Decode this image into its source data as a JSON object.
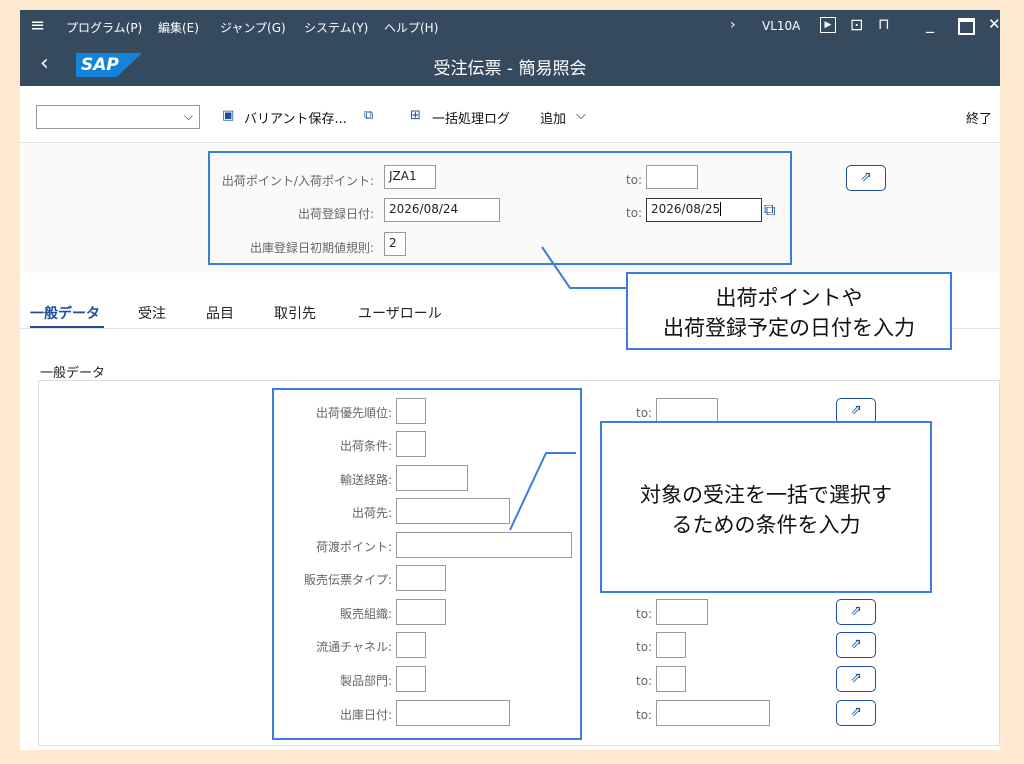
{
  "menu": {
    "items": [
      "プログラム(P)",
      "編集(E)",
      "ジャンプ(G)",
      "システム(Y)",
      "ヘルプ(H)"
    ],
    "tcode": "VL10A"
  },
  "title": "受注伝票 - 簡易照会",
  "toolbar": {
    "variant_save": "バリアント保存...",
    "batch_log": "一括処理ログ",
    "add": "追加",
    "exit": "終了"
  },
  "header_fields": {
    "shipping_point_label": "出荷ポイント/入荷ポイント:",
    "shipping_point_value": "JZA1",
    "ship_date_label": "出荷登録日付:",
    "ship_date_from": "2026/08/24",
    "ship_date_to": "2026/08/25",
    "rule_label": "出庫登録日初期値規則:",
    "rule_value": "2",
    "to_label": "to:"
  },
  "tabs": [
    "一般データ",
    "受注",
    "品目",
    "取引先",
    "ユーザロール"
  ],
  "section_title": "一般データ",
  "general_fields": [
    {
      "label": "出荷優先順位:"
    },
    {
      "label": "出荷条件:"
    },
    {
      "label": "輸送経路:"
    },
    {
      "label": "出荷先:"
    },
    {
      "label": "荷渡ポイント:"
    },
    {
      "label": "販売伝票タイプ:"
    },
    {
      "label": "販売組織:"
    },
    {
      "label": "流通チャネル:"
    },
    {
      "label": "製品部門:"
    },
    {
      "label": "出庫日付:"
    }
  ],
  "callouts": {
    "top": [
      "出荷ポイントや",
      "出荷登録予定の日付を入力"
    ],
    "bottom": [
      "対象の受注を一括で選択す",
      "るための条件を入力"
    ]
  },
  "colors": {
    "header_bg": "#354a5f",
    "sap_blue": "#1584d8",
    "annotation": "#3b7ddd",
    "page_bg": "#fde9cf"
  }
}
